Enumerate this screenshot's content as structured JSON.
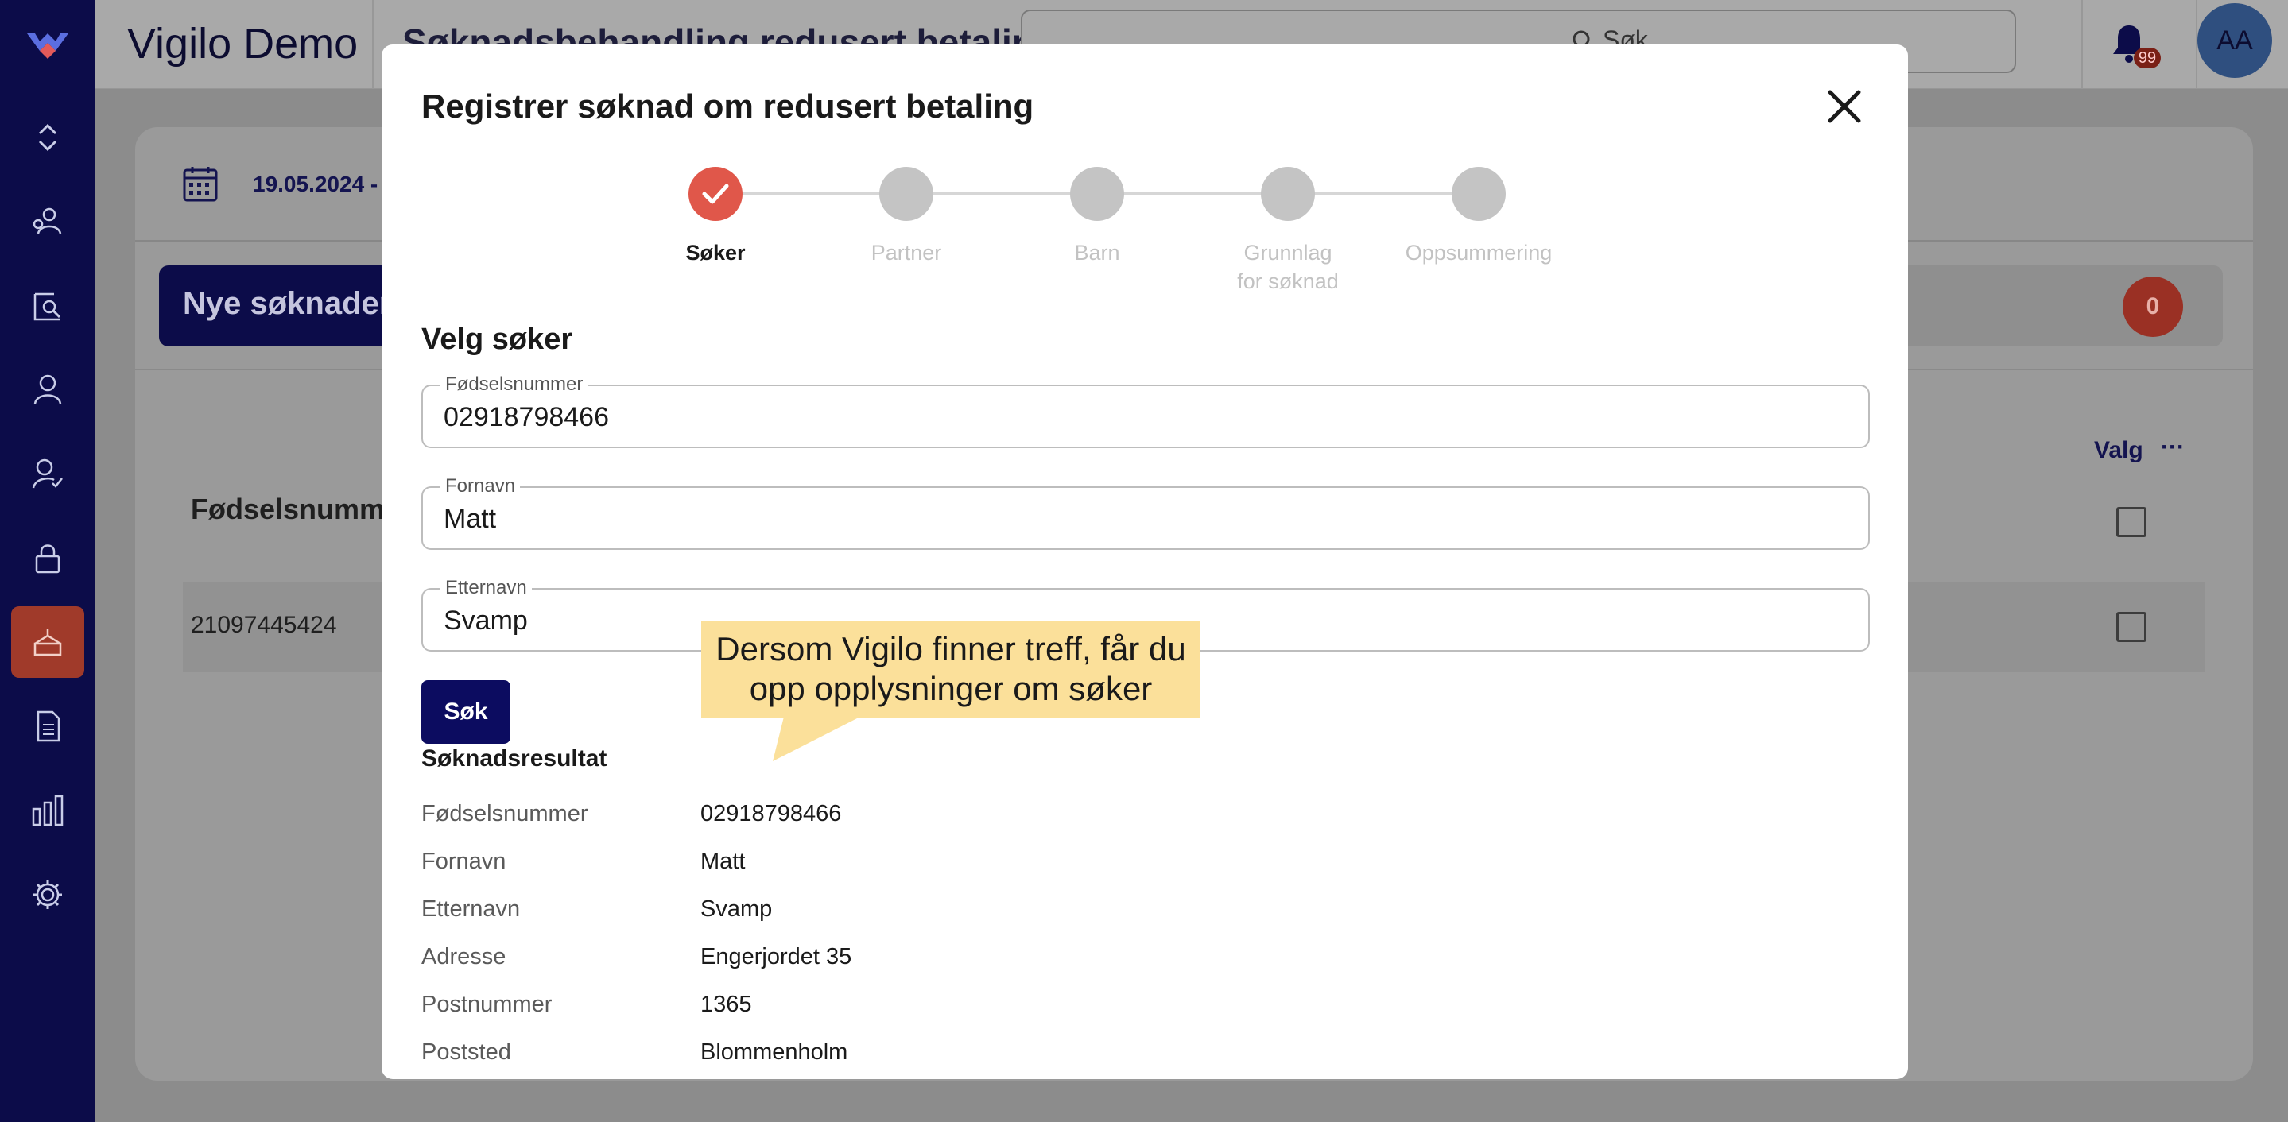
{
  "app": {
    "title": "Vigilo Demo",
    "page_heading": "Søknadsbehandling redusert betaling",
    "search_placeholder": "Søk",
    "notification_count": "99",
    "user_initials": "AA"
  },
  "sidebar": {
    "items": [
      {
        "icon": "chevron-up-down-icon"
      },
      {
        "icon": "users-search-icon"
      },
      {
        "icon": "chart-search-icon"
      },
      {
        "icon": "person-icon"
      },
      {
        "icon": "person-check-icon"
      },
      {
        "icon": "lock-icon"
      },
      {
        "icon": "cake-icon",
        "active": true
      },
      {
        "icon": "document-icon"
      },
      {
        "icon": "bar-chart-icon"
      },
      {
        "icon": "gear-icon"
      }
    ]
  },
  "background": {
    "date_range": "19.05.2024 -",
    "active_tab": "Nye søknader",
    "count": "0",
    "column_header": "Fødselsnummer",
    "valg_label": "Valg",
    "more_label": "···",
    "rows": [
      {
        "fodselsnummer": "21097445424"
      }
    ]
  },
  "modal": {
    "title": "Registrer søknad om redusert betaling",
    "steps": [
      {
        "label": "Søker",
        "state": "done"
      },
      {
        "label": "Partner",
        "state": "pending"
      },
      {
        "label": "Barn",
        "state": "pending"
      },
      {
        "label": "Grunnlag for søknad",
        "state": "pending"
      },
      {
        "label": "Oppsummering",
        "state": "pending"
      }
    ],
    "section_title": "Velg søker",
    "fields": {
      "fodselsnummer": {
        "label": "Fødselsnummer",
        "value": "02918798466"
      },
      "fornavn": {
        "label": "Fornavn",
        "value": "Matt"
      },
      "etternavn": {
        "label": "Etternavn",
        "value": "Svamp"
      }
    },
    "search_button": "Søk",
    "result_title": "Søknadsresultat",
    "results": [
      {
        "label": "Fødselsnummer",
        "value": "02918798466"
      },
      {
        "label": "Fornavn",
        "value": "Matt"
      },
      {
        "label": "Etternavn",
        "value": "Svamp"
      },
      {
        "label": "Adresse",
        "value": "Engerjordet 35"
      },
      {
        "label": "Postnummer",
        "value": "1365"
      },
      {
        "label": "Poststed",
        "value": "Blommenholm"
      }
    ]
  },
  "callout": {
    "line1": "Dersom Vigilo finner treff, får du",
    "line2": "opp opplysninger om søker"
  },
  "colors": {
    "navy": "#0c0c49",
    "accent_red": "#e0574a",
    "callout_yellow": "#fbe09a"
  }
}
